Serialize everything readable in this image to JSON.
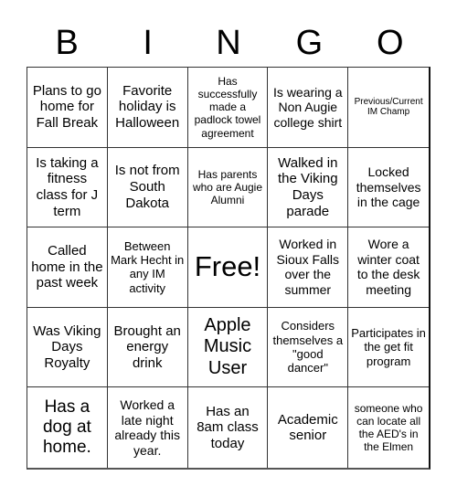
{
  "header": {
    "letters": [
      "B",
      "I",
      "N",
      "G",
      "O"
    ]
  },
  "cells": [
    "Plans to go home for Fall Break",
    "Favorite holiday is Halloween",
    "Has successfully made a padlock towel agreement",
    "Is wearing a Non Augie college shirt",
    "Previous/Current IM Champ",
    "Is taking a fitness class for J term",
    "Is not from South Dakota",
    "Has parents who are Augie Alumni",
    "Walked in the Viking Days parade",
    "Locked themselves in the cage",
    "Called home in the past week",
    "Between Mark Hecht in any IM activity",
    "Free!",
    "Worked in Sioux Falls over the summer",
    "Wore a winter coat to the desk meeting",
    "Was Viking Days Royalty",
    "Brought an energy drink",
    "Apple Music User",
    "Considers themselves a \"good dancer\"",
    "Participates in the get fit program",
    "Has a dog at home.",
    "Worked a late night already this year.",
    "Has an 8am class today",
    "Academic senior",
    "someone who can locate all the AED's in the Elmen"
  ]
}
